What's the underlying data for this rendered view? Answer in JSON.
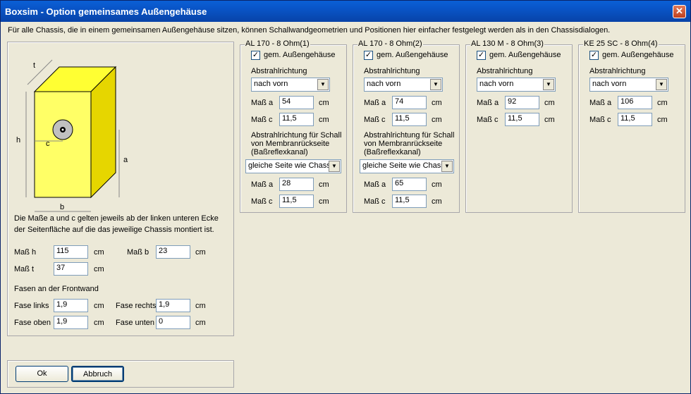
{
  "window": {
    "title": "Boxsim - Option gemeinsames Außengehäuse",
    "close_glyph": "✕"
  },
  "intro": "Für alle Chassis, die in einem gemeinsamen Außengehäuse sitzen, können Schallwandgeometrien und Positionen hier einfacher festgelegt werden als in den Chassisdialogen.",
  "diagram": {
    "t": "t",
    "h": "h",
    "c": "c",
    "a": "a",
    "b": "b",
    "box_color": "#ffff33"
  },
  "left": {
    "desc": "Die Maße a und c gelten jeweils ab der linken unteren Ecke der Seitenfläche auf die das jeweilige Chassis montiert ist.",
    "h_label": "Maß h",
    "h_value": "115",
    "h_unit": "cm",
    "b_label": "Maß b",
    "b_value": "23",
    "b_unit": "cm",
    "t_label": "Maß t",
    "t_value": "37",
    "t_unit": "cm",
    "fasen_title": "Fasen an der Frontwand",
    "fl_label": "Fase links",
    "fl_value": "1,9",
    "fl_unit": "cm",
    "fr_label": "Fase rechts",
    "fr_value": "1,9",
    "fr_unit": "cm",
    "fo_label": "Fase oben",
    "fo_value": "1,9",
    "fo_unit": "cm",
    "fu_label": "Fase unten",
    "fu_value": "0",
    "fu_unit": "cm"
  },
  "buttons": {
    "ok": "Ok",
    "cancel": "Abbruch"
  },
  "common": {
    "gem": "gem. Außengehäuse",
    "dir_label": "Abstrahlrichtung",
    "mass_a": "Maß a",
    "mass_c": "Maß c",
    "unit": "cm",
    "rear_title": "Abstrahlrichtung für Schall von Membranrückseite (Baßreflexkanal)",
    "check_glyph": "✓",
    "arrow_glyph": "▼"
  },
  "chassis": [
    {
      "title": "AL 170 - 8 Ohm(1)",
      "dir": "nach vorn",
      "a": "54",
      "c": "11,5",
      "rear": "gleiche Seite wie Chass",
      "rear_a": "28",
      "rear_c": "11,5"
    },
    {
      "title": "AL 170 - 8 Ohm(2)",
      "dir": "nach vorn",
      "a": "74",
      "c": "11,5",
      "rear": "gleiche Seite wie Chass",
      "rear_a": "65",
      "rear_c": "11,5"
    },
    {
      "title": "AL 130 M - 8 Ohm(3)",
      "dir": "nach vorn",
      "a": "92",
      "c": "11,5"
    },
    {
      "title": "KE 25 SC - 8 Ohm(4)",
      "dir": "nach vorn",
      "a": "106",
      "c": "11,5"
    }
  ]
}
